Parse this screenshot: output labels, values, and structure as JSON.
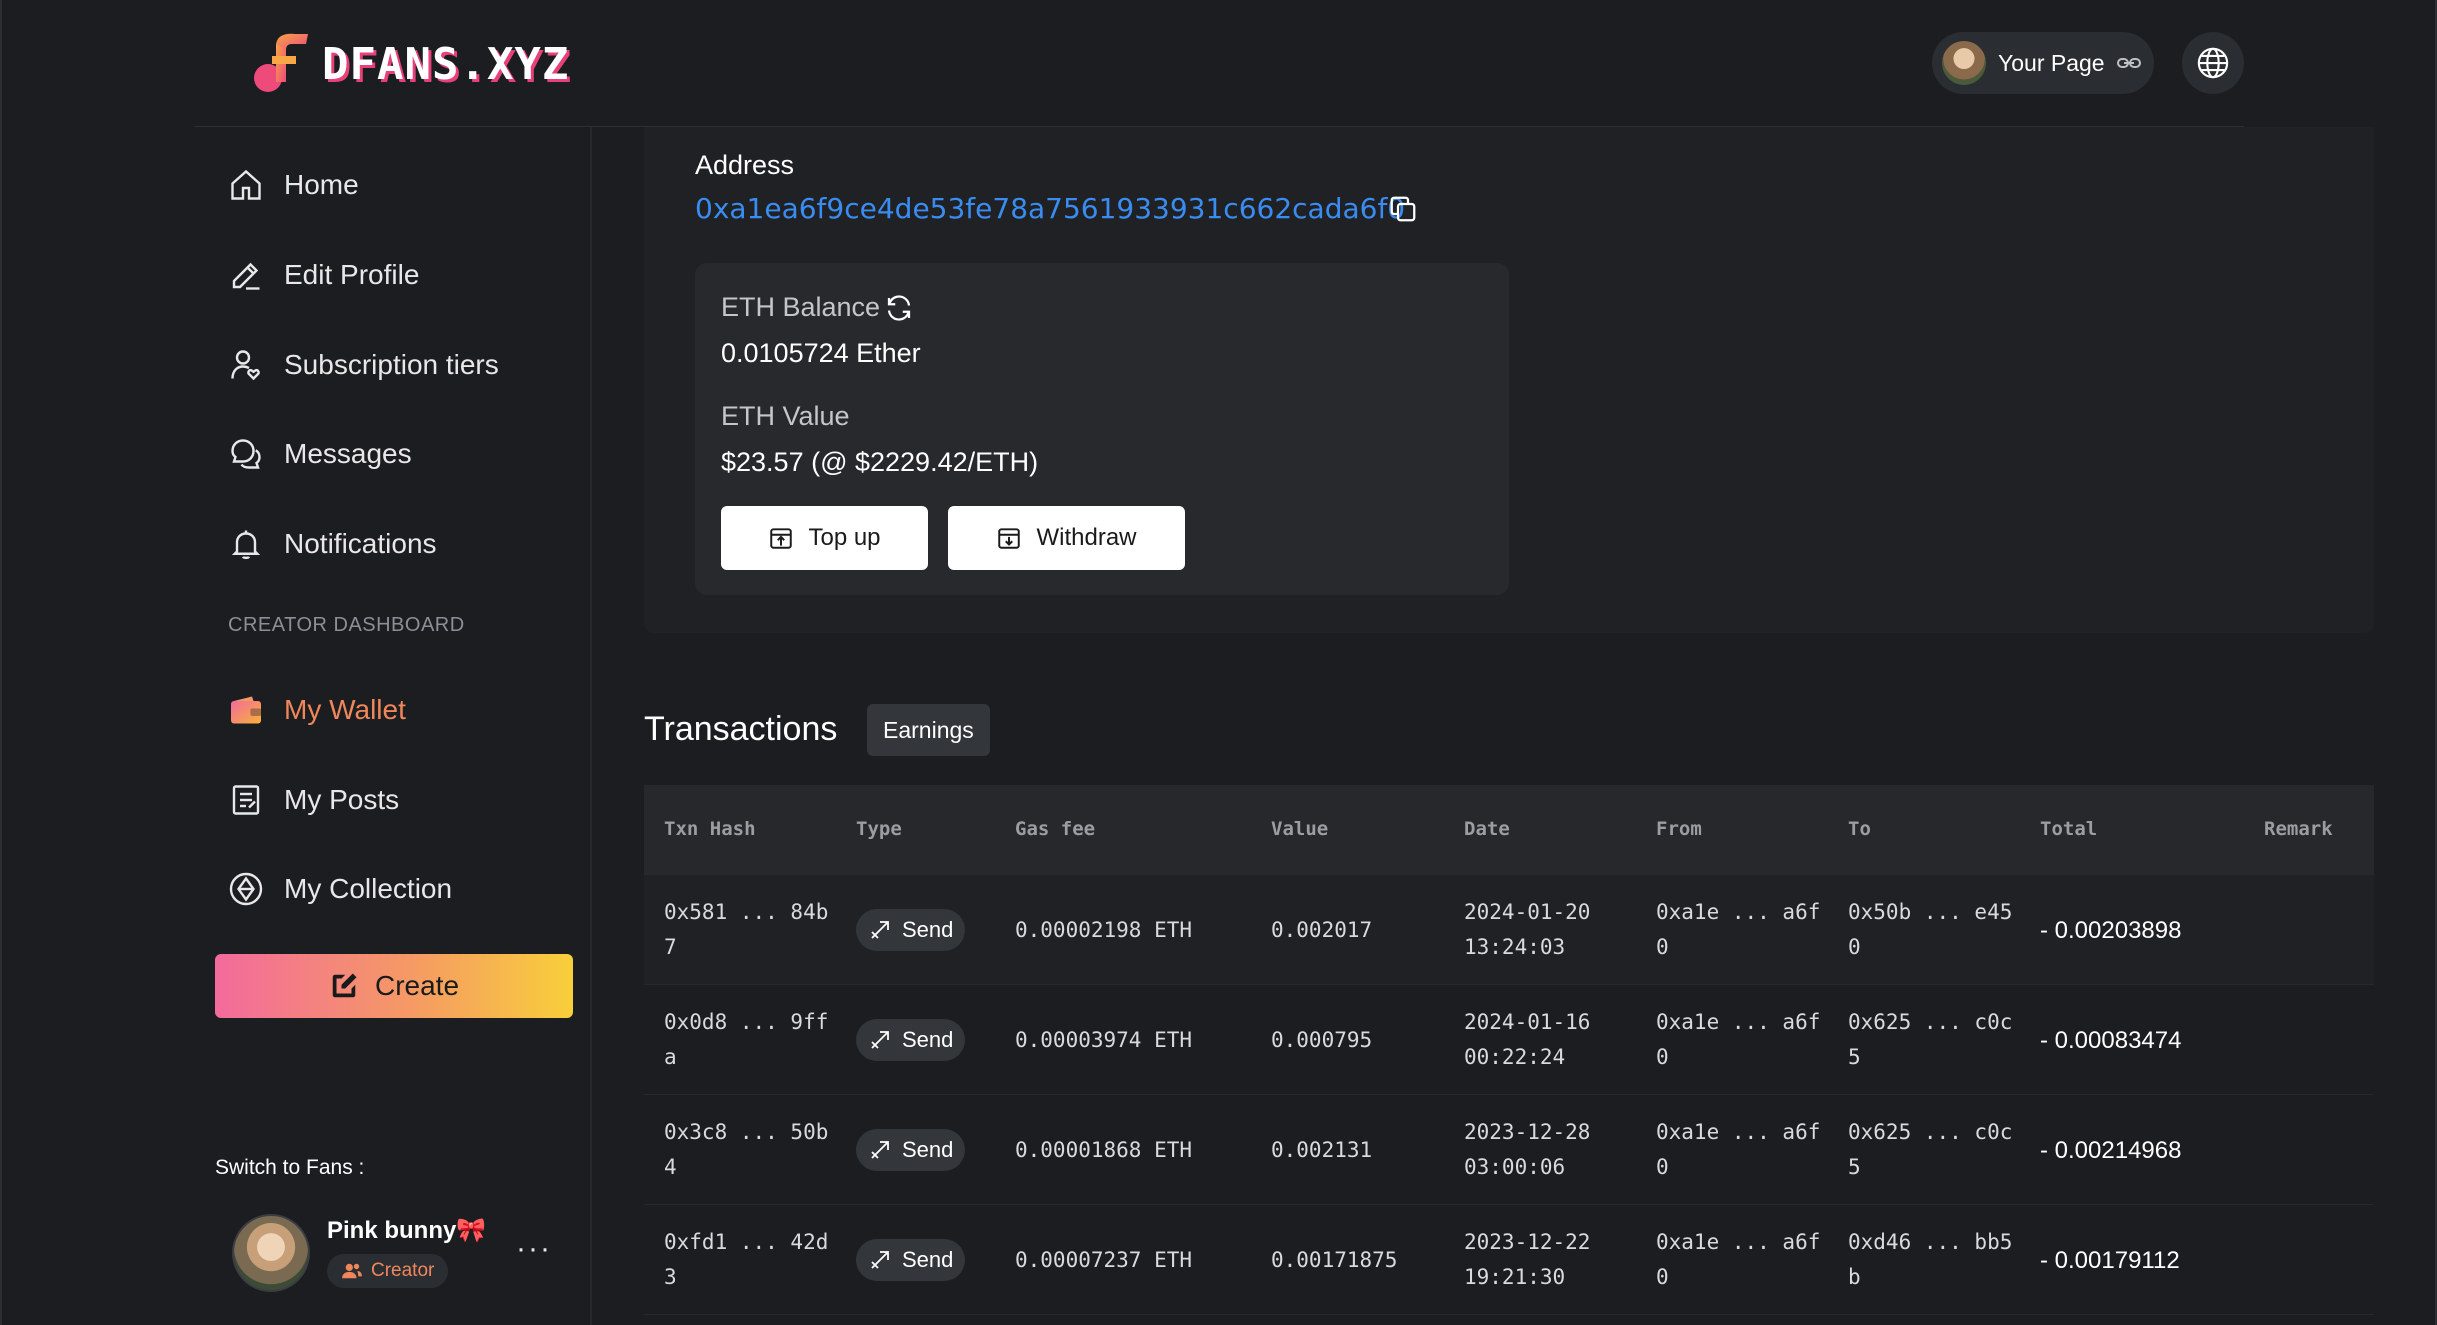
{
  "brand": {
    "name": "DFANS.XYZ"
  },
  "header": {
    "your_page_label": "Your Page"
  },
  "sidebar": {
    "items": [
      {
        "label": "Home",
        "icon": "home-icon"
      },
      {
        "label": "Edit Profile",
        "icon": "pencil-icon"
      },
      {
        "label": "Subscription tiers",
        "icon": "user-heart-icon"
      },
      {
        "label": "Messages",
        "icon": "chat-icon"
      },
      {
        "label": "Notifications",
        "icon": "bell-icon"
      }
    ],
    "section_label": "CREATOR DASHBOARD",
    "dashboard_items": [
      {
        "label": "My Wallet",
        "icon": "wallet-icon",
        "active": true
      },
      {
        "label": "My Posts",
        "icon": "document-icon"
      },
      {
        "label": "My Collection",
        "icon": "collection-icon"
      }
    ],
    "create_label": "Create",
    "switch_label": "Switch to Fans :",
    "profile": {
      "name": "Pink bunny🎀",
      "role": "Creator"
    }
  },
  "wallet": {
    "address_label": "Address",
    "address": "0xa1ea6f9ce4de53fe78a7561933931c662cada6f0",
    "balance_label": "ETH Balance",
    "balance_value": "0.0105724 Ether",
    "value_label": "ETH Value",
    "value_value": "$23.57 (@ $2229.42/ETH)",
    "topup_label": "Top up",
    "withdraw_label": "Withdraw"
  },
  "transactions": {
    "title": "Transactions",
    "filter_label": "Earnings",
    "columns": [
      "Txn Hash",
      "Type",
      "Gas fee",
      "Value",
      "Date",
      "From",
      "To",
      "Total",
      "Remark"
    ],
    "rows": [
      {
        "hash1": "0x581 ... 84b",
        "hash2": "7",
        "type": "Send",
        "gas": "0.00002198 ETH",
        "value": "0.002017",
        "date1": "2024-01-20",
        "date2": "13:24:03",
        "from1": "0xa1e ... a6f",
        "from2": "0",
        "to1": "0x50b ... e45",
        "to2": "0",
        "total": "- 0.00203898",
        "remark": ""
      },
      {
        "hash1": "0x0d8 ... 9ff",
        "hash2": "a",
        "type": "Send",
        "gas": "0.00003974 ETH",
        "value": "0.000795",
        "date1": "2024-01-16",
        "date2": "00:22:24",
        "from1": "0xa1e ... a6f",
        "from2": "0",
        "to1": "0x625 ... c0c",
        "to2": "5",
        "total": "- 0.00083474",
        "remark": ""
      },
      {
        "hash1": "0x3c8 ... 50b",
        "hash2": "4",
        "type": "Send",
        "gas": "0.00001868 ETH",
        "value": "0.002131",
        "date1": "2023-12-28",
        "date2": "03:00:06",
        "from1": "0xa1e ... a6f",
        "from2": "0",
        "to1": "0x625 ... c0c",
        "to2": "5",
        "total": "- 0.00214968",
        "remark": ""
      },
      {
        "hash1": "0xfd1 ... 42d",
        "hash2": "3",
        "type": "Send",
        "gas": "0.00007237 ETH",
        "value": "0.00171875",
        "date1": "2023-12-22",
        "date2": "19:21:30",
        "from1": "0xa1e ... a6f",
        "from2": "0",
        "to1": "0xd46 ... bb5",
        "to2": "b",
        "total": "- 0.00179112",
        "remark": ""
      }
    ]
  },
  "colors": {
    "accent": "#f0875b",
    "link": "#3a8cf0",
    "background": "#1b1d20"
  }
}
